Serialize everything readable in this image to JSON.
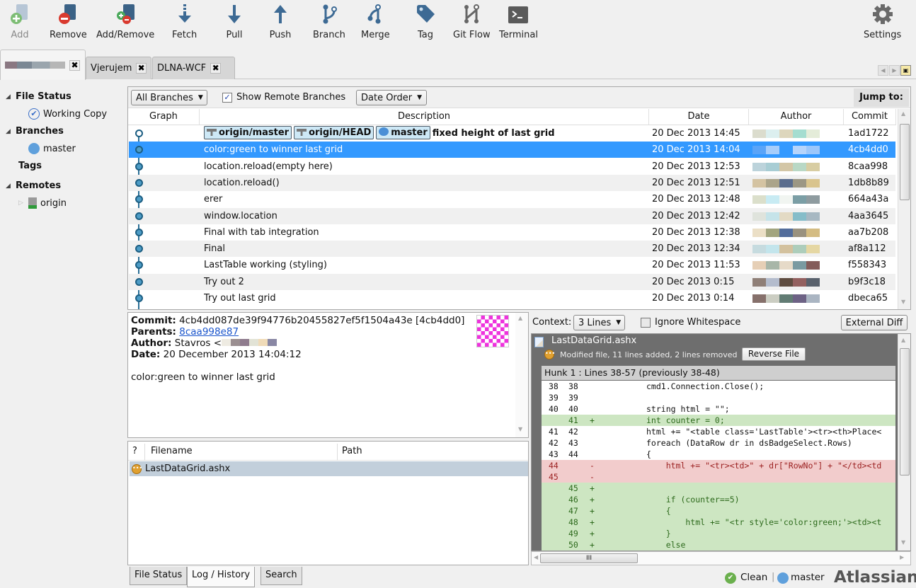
{
  "toolbar": {
    "buttons": [
      {
        "label": "Add",
        "icon": "add-file-icon",
        "enabled": false
      },
      {
        "label": "Remove",
        "icon": "remove-file-icon",
        "enabled": true
      },
      {
        "label": "Add/Remove",
        "icon": "add-remove-icon",
        "enabled": true
      },
      {
        "label": "Fetch",
        "icon": "fetch-icon",
        "enabled": true
      },
      {
        "label": "Pull",
        "icon": "pull-arrow-icon",
        "enabled": true
      },
      {
        "label": "Push",
        "icon": "push-arrow-icon",
        "enabled": true
      },
      {
        "label": "Branch",
        "icon": "branch-icon",
        "enabled": true
      },
      {
        "label": "Merge",
        "icon": "merge-icon",
        "enabled": true
      },
      {
        "label": "Tag",
        "icon": "tag-icon",
        "enabled": true
      },
      {
        "label": "Git Flow",
        "icon": "git-flow-icon",
        "enabled": true
      },
      {
        "label": "Terminal",
        "icon": "terminal-icon",
        "enabled": true
      }
    ],
    "settings_label": "Settings"
  },
  "tabs": [
    {
      "label": "",
      "redacted": true,
      "active": true
    },
    {
      "label": "Vjerujem",
      "active": false
    },
    {
      "label": "DLNA-WCF",
      "active": false
    }
  ],
  "tab_close_glyph": "✖",
  "sidebar": {
    "file_status": "File Status",
    "working_copy": "Working Copy",
    "branches": "Branches",
    "branch_master": "master",
    "tags": "Tags",
    "remotes": "Remotes",
    "remote_origin": "origin"
  },
  "history": {
    "branch_filter": "All Branches",
    "show_remote_label": "Show Remote Branches",
    "show_remote_checked": true,
    "order": "Date Order",
    "jump_to": "Jump to:",
    "columns": [
      "Graph",
      "Description",
      "Date",
      "Author",
      "Commit"
    ],
    "refs": [
      "origin/master",
      "origin/HEAD",
      "master"
    ],
    "rows": [
      {
        "desc": "fixed height of last grid",
        "date": "20 Dec 2013 14:45",
        "commit": "1ad1722",
        "bold": true,
        "author_colors": [
          "#dbdccd",
          "#dcefef",
          "#ddd6bc",
          "#a5ddd0",
          "#e4ecd9"
        ]
      },
      {
        "desc": "color:green to winner last grid",
        "date": "20 Dec 2013 14:04",
        "commit": "4cb4dd0",
        "selected": true,
        "author_colors": [
          "#5aa4f8",
          "#a6cdfb",
          "#3399ff",
          "#b6d4fb",
          "#9cc7fb"
        ]
      },
      {
        "desc": "location.reload(empty here)",
        "date": "20 Dec 2013 12:53",
        "commit": "8caa998",
        "author_colors": [
          "#bcd3db",
          "#a8cdd4",
          "#d3c6a6",
          "#b9d8c5",
          "#d8cda2"
        ]
      },
      {
        "desc": "location.reload()",
        "date": "20 Dec 2013 12:51",
        "commit": "1db8b89",
        "author_colors": [
          "#d4c3a2",
          "#aba48a",
          "#5b6d8e",
          "#9c9784",
          "#d9c48d"
        ]
      },
      {
        "desc": "erer",
        "date": "20 Dec 2013 12:48",
        "commit": "664a43a",
        "author_colors": [
          "#dbdfcb",
          "#c8ebf3",
          "#f1f5f1",
          "#7b9ea5",
          "#8e9b9f"
        ]
      },
      {
        "desc": "window.location",
        "date": "20 Dec 2013 12:42",
        "commit": "4aa3645",
        "author_colors": [
          "#dfe3dc",
          "#c5e3e9",
          "#e3dac4",
          "#86bdc9",
          "#a7b8c2"
        ]
      },
      {
        "desc": "Final with tab integration",
        "date": "20 Dec 2013 12:38",
        "commit": "aa7b208",
        "author_colors": [
          "#ebdfc6",
          "#a2a57f",
          "#536d9b",
          "#9a927f",
          "#d4bc82"
        ]
      },
      {
        "desc": "Final",
        "date": "20 Dec 2013 12:34",
        "commit": "af8a112",
        "author_colors": [
          "#c6dbdf",
          "#c3e5ec",
          "#d3c19e",
          "#adcdbb",
          "#e5d7a3"
        ]
      },
      {
        "desc": "LastTable working (styling)",
        "date": "20 Dec 2013 11:53",
        "commit": "f558343",
        "author_colors": [
          "#e6cfb6",
          "#a8b6a8",
          "#e6dac8",
          "#7a9aa1",
          "#845c5a"
        ]
      },
      {
        "desc": "Try out 2",
        "date": "20 Dec 2013 0:15",
        "commit": "b9f3c18",
        "author_colors": [
          "#8f7f77",
          "#b4bccd",
          "#5e4c40",
          "#93605f",
          "#59616c"
        ]
      },
      {
        "desc": "Try out last grid",
        "date": "20 Dec 2013 0:14",
        "commit": "dbeca65",
        "author_colors": [
          "#86706b",
          "#cbcdc2",
          "#627c74",
          "#6d6285",
          "#aab5c2"
        ]
      }
    ]
  },
  "details": {
    "commit_label": "Commit:",
    "commit_hash": "4cb4dd087de39f94776b20455827ef5f1504a43e [4cb4dd0]",
    "parents_label": "Parents:",
    "parents": "8caa998e87",
    "author_label": "Author:",
    "author": "Stavros <",
    "author_email_colors": [
      "#eeebe2",
      "#9b8f91",
      "#8f7c8e",
      "#e2e3d6",
      "#f0dbb8",
      "#8987a4"
    ],
    "date_label": "Date:",
    "date": "20 December 2013 14:04:12",
    "message": "color:green to winner last grid"
  },
  "files": {
    "columns": [
      "?",
      "Filename",
      "Path"
    ],
    "rows": [
      {
        "filename": "LastDataGrid.ashx",
        "path": "",
        "status": "modified"
      }
    ]
  },
  "bottom_tabs": [
    {
      "label": "File Status",
      "active": false
    },
    {
      "label": "Log / History",
      "active": true
    },
    {
      "label": "Search",
      "active": false
    }
  ],
  "diff": {
    "context_label": "Context:",
    "context_value": "3 Lines",
    "ignore_whitespace": "Ignore Whitespace",
    "ignore_whitespace_checked": false,
    "external_diff": "External Diff",
    "filename": "LastDataGrid.ashx",
    "summary": "Modified file, 11 lines added, 2 lines removed",
    "reverse_file": "Reverse File",
    "hunk_header": "Hunk 1 : Lines 38-57 (previously 38-48)",
    "lines": [
      {
        "old": "38",
        "new": "38",
        "sign": "",
        "type": "ctx",
        "code": "cmd1.Connection.Close();"
      },
      {
        "old": "39",
        "new": "39",
        "sign": "",
        "type": "ctx",
        "code": ""
      },
      {
        "old": "40",
        "new": "40",
        "sign": "",
        "type": "ctx",
        "code": "string html = \"\";"
      },
      {
        "old": "",
        "new": "41",
        "sign": "+",
        "type": "add",
        "code": "int counter = 0;"
      },
      {
        "old": "41",
        "new": "42",
        "sign": "",
        "type": "ctx",
        "code": "html += \"<table class='LastTable'><tr><th>Place<"
      },
      {
        "old": "42",
        "new": "43",
        "sign": "",
        "type": "ctx",
        "code": "foreach (DataRow dr in dsBadgeSelect.Rows)"
      },
      {
        "old": "43",
        "new": "44",
        "sign": "",
        "type": "ctx",
        "code": "{"
      },
      {
        "old": "44",
        "new": "",
        "sign": "-",
        "type": "del",
        "code": "    html += \"<tr><td>\" + dr[\"RowNo\"] + \"</td><td"
      },
      {
        "old": "45",
        "new": "",
        "sign": "-",
        "type": "del",
        "code": ""
      },
      {
        "old": "",
        "new": "45",
        "sign": "+",
        "type": "add",
        "code": ""
      },
      {
        "old": "",
        "new": "46",
        "sign": "+",
        "type": "add",
        "code": "    if (counter==5)"
      },
      {
        "old": "",
        "new": "47",
        "sign": "+",
        "type": "add",
        "code": "    {"
      },
      {
        "old": "",
        "new": "48",
        "sign": "+",
        "type": "add",
        "code": "        html += \"<tr style='color:green;'><td><t"
      },
      {
        "old": "",
        "new": "49",
        "sign": "+",
        "type": "add",
        "code": "    }"
      },
      {
        "old": "",
        "new": "50",
        "sign": "+",
        "type": "add",
        "code": "    else"
      }
    ]
  },
  "status": {
    "clean": "Clean",
    "separator": "|",
    "branch": "master",
    "brand": "Atlassian"
  }
}
